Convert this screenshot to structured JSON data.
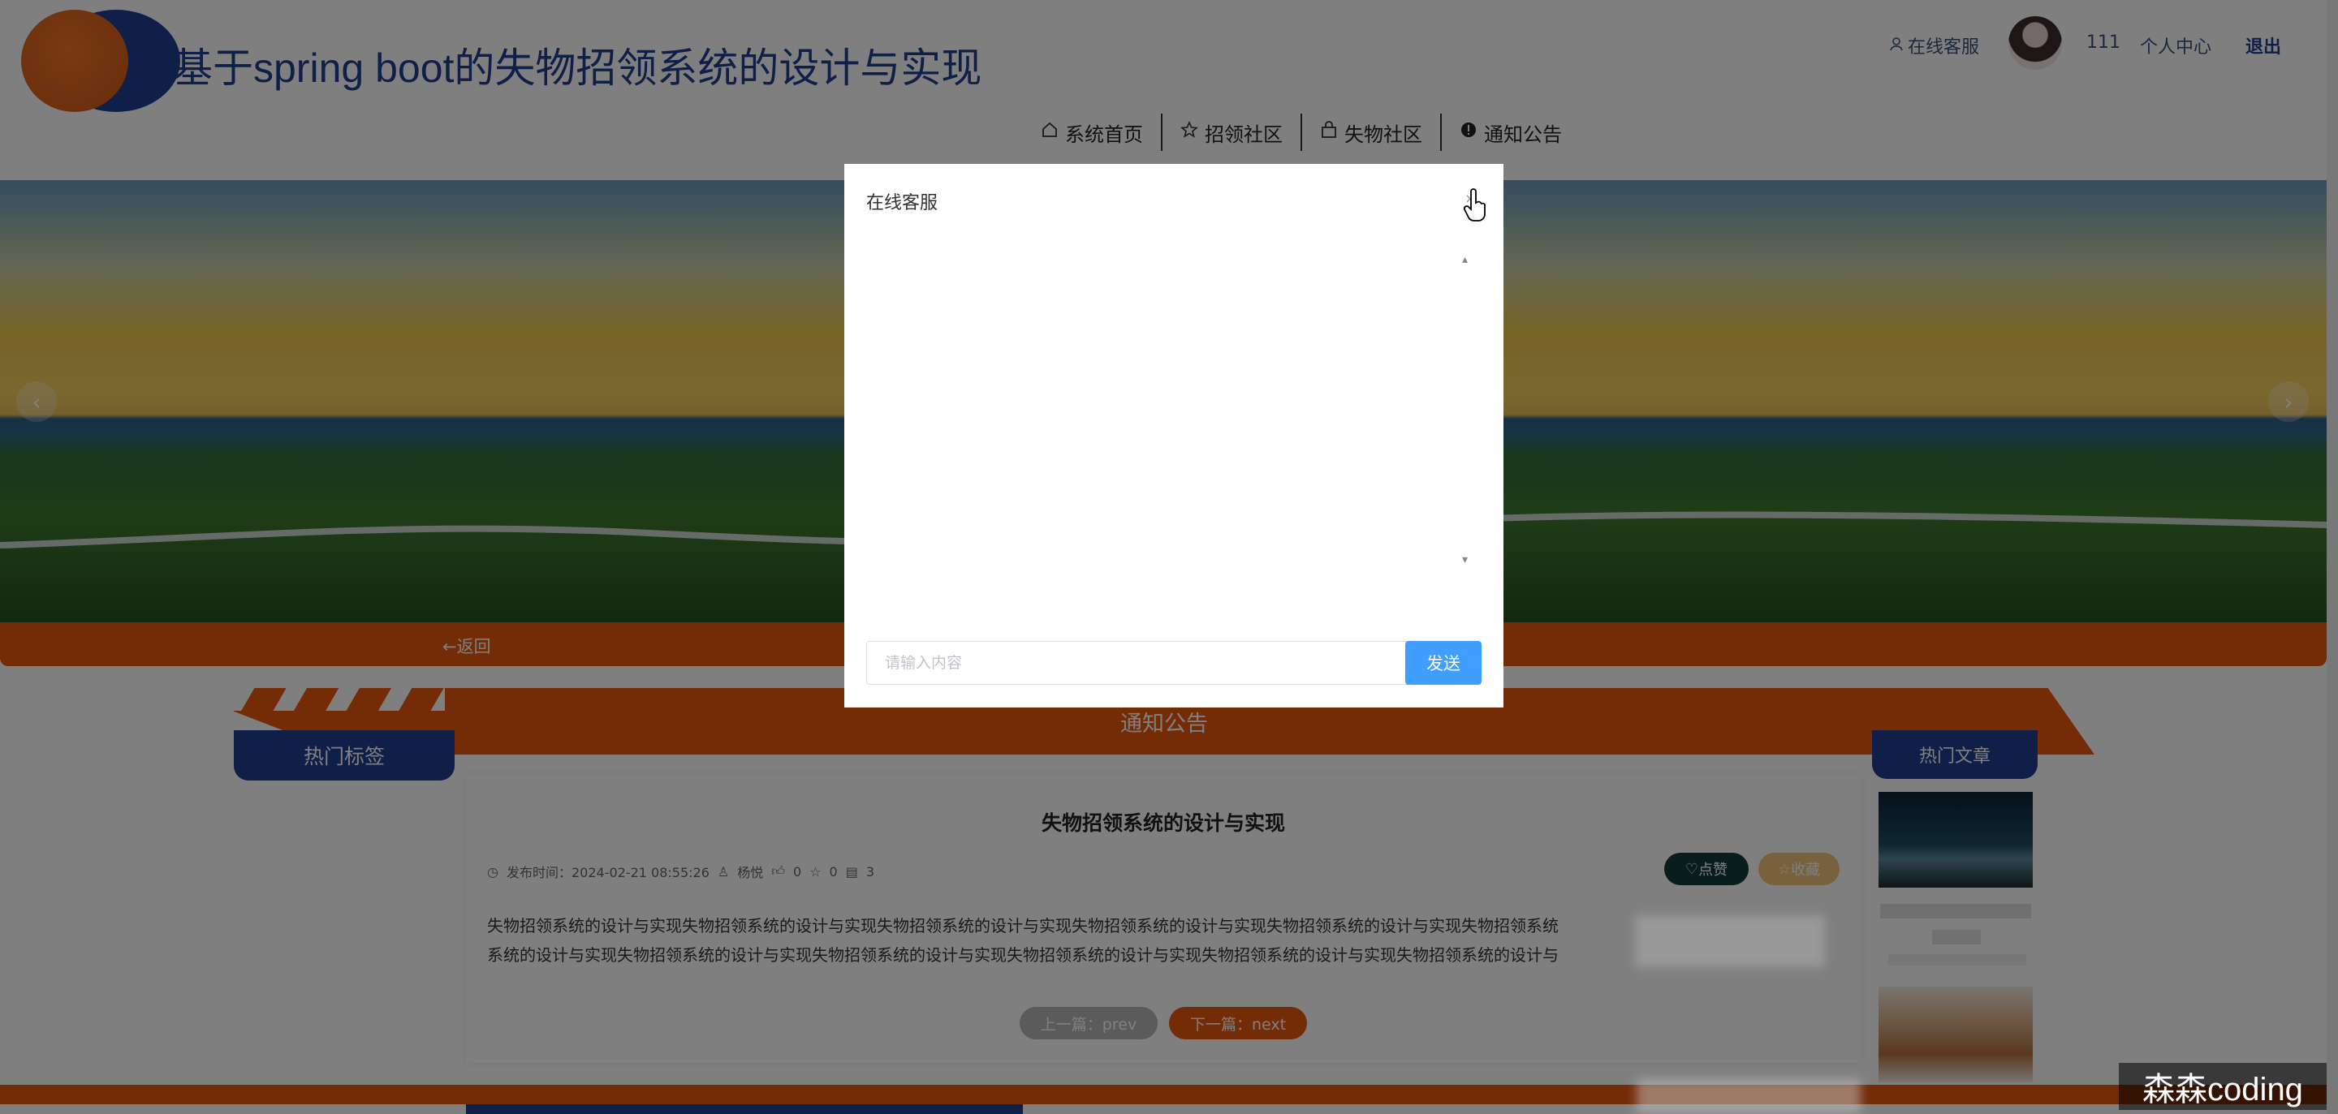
{
  "header": {
    "site_title": "基于spring boot的失物招领系统的设计与实现",
    "online_service": "在线客服",
    "username": "111",
    "user_center": "个人中心",
    "logout": "退出"
  },
  "nav": {
    "items": [
      {
        "label": "系统首页",
        "icon": "home-icon"
      },
      {
        "label": "招领社区",
        "icon": "star-icon"
      },
      {
        "label": "失物社区",
        "icon": "bag-icon"
      },
      {
        "label": "通知公告",
        "icon": "alert-icon"
      }
    ]
  },
  "banner": {
    "prev_arrow": "‹",
    "next_arrow": "›"
  },
  "page": {
    "back_link": "←返回",
    "section_title": "通知公告",
    "hot_tags": "热门标签",
    "hot_articles": "热门文章"
  },
  "article": {
    "title": "失物招领系统的设计与实现",
    "published_label": "发布时间：",
    "published": "2024-02-21 08:55:26",
    "author": "杨悦",
    "likes": "0",
    "favorites": "0",
    "comments": "3",
    "like_button": "点赞",
    "fav_button": "收藏",
    "body_line1": "失物招领系统的设计与实现失物招领系统的设计与实现失物招领系统的设计与实现失物招领系统的设计与实现失物招领系统的设计与实现失物招领系统",
    "body_line2": "系统的设计与实现失物招领系统的设计与实现失物招领系统的设计与实现失物招领系统的设计与实现失物招领系统的设计与实现失物招领系统的设计与",
    "prev_button": "上一篇：prev",
    "next_button": "下一篇：next"
  },
  "dialog": {
    "title": "在线客服",
    "close": "×",
    "input_placeholder": "请输入内容",
    "input_value": "",
    "send_button": "发送"
  },
  "watermark": "森森coding",
  "colors": {
    "brand_blue": "#1f3f8f",
    "brand_orange": "#e8580f",
    "send_blue": "#409eff"
  }
}
